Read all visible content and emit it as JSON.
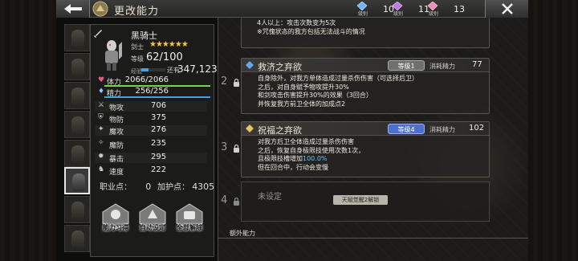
{
  "header": {
    "title": "更改能力",
    "resources": [
      {
        "icon": "blue-crystal-icon",
        "label": "级别",
        "count": "10"
      },
      {
        "icon": "purple-crystal-icon",
        "label": "级别",
        "count": "11"
      },
      {
        "icon": "pink-crystal-icon",
        "label": "级别",
        "count": "13"
      }
    ]
  },
  "character": {
    "name": "黑骑士",
    "job": "剑士",
    "stars": "★★★★★★",
    "star_count": 6,
    "level_label": "等级",
    "level": "62/100",
    "exp_label": "经验",
    "exp_progress": 0.3,
    "exp_remaining_label": "还有",
    "exp_remaining": "347,123",
    "hp_label": "体力",
    "hp": "2066/2066",
    "hp_fraction": 1.0,
    "mp_label": "精力",
    "mp": "256/256",
    "mp_fraction": 1.0,
    "stats": [
      {
        "label": "物攻",
        "value": "706",
        "icon": "sword-icon"
      },
      {
        "label": "物防",
        "value": "375",
        "icon": "shield-icon"
      },
      {
        "label": "魔攻",
        "value": "276",
        "icon": "magic-attack-icon"
      },
      {
        "label": "魔防",
        "value": "235",
        "icon": "magic-defense-icon"
      },
      {
        "label": "暴击",
        "value": "295",
        "icon": "crit-icon"
      },
      {
        "label": "速度",
        "value": "222",
        "icon": "boot-icon"
      }
    ],
    "job_points_label": "职业点：",
    "job_points": "0",
    "bonus_points_label": "加护点：",
    "bonus_points": "4305",
    "buttons": [
      "能力习得",
      "自动设定",
      "全部解除"
    ]
  },
  "colors": {
    "hp": "#7ad14a",
    "mp": "#4a9ee0",
    "accent_blue": "#4f6fd0",
    "gold": "#f5c842"
  },
  "previous_card": {
    "lines": [
      "4人以上：攻击次数变为5次",
      "※咒傀状态的我方包括无法战斗的情况"
    ]
  },
  "skills": [
    {
      "slot": "2",
      "name": "救济之弃欲",
      "badge": "等级1",
      "cost_label": "消耗精力",
      "cost": "77",
      "lines": [
        "自身除外，对我方单体造成过量杀伤伤害（可选择后卫）",
        "之后，对自身赋予物攻提升30%",
        "和剑攻击伤害提升30%的效果（3回合）",
        "并恢复我方前卫全体的加成点2"
      ]
    },
    {
      "slot": "3",
      "name": "祝福之弃欲",
      "badge": "等级4",
      "cost_label": "消耗精力",
      "cost": "102",
      "lines": [
        "对我方后卫全体造成过量杀伤伤害",
        "之后，恢复自身极限技使用次数1次，",
        "且极限技槽增加",
        "但在回合中，行动会变慢"
      ],
      "highlight": "100.0%"
    }
  ],
  "unset": {
    "slot": "4",
    "label": "未设定",
    "badge": "天赋觉醒2解锁"
  },
  "extra_label": "额外能力"
}
